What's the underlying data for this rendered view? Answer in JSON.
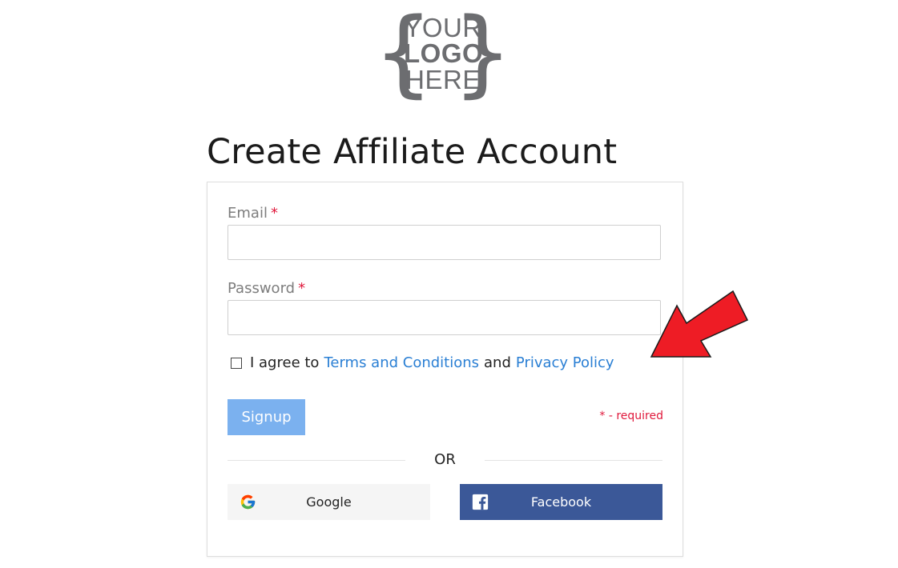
{
  "logo": {
    "brace_left": "{",
    "brace_right": "}",
    "line1": "YOUR",
    "line2": "LOGO",
    "line3": "HERE"
  },
  "page_title": "Create Affiliate Account",
  "form": {
    "email_label": "Email",
    "password_label": "Password",
    "required_marker": "*",
    "email_value": "",
    "password_value": "",
    "agree_prefix": "I agree to",
    "terms_link": "Terms and Conditions",
    "agree_and": "and",
    "privacy_link": "Privacy Policy",
    "agree_checked": false,
    "signup_label": "Signup",
    "required_note": "* - required",
    "or_text": "OR",
    "google_label": "Google",
    "facebook_label": "Facebook"
  },
  "icons": {
    "google": "google-g-icon",
    "facebook": "facebook-f-icon",
    "annotation": "red-arrow-icon"
  },
  "colors": {
    "link": "#2a7fd4",
    "required": "#e0193c",
    "signup_button": "#7bb1ef",
    "facebook_button": "#3b5898",
    "google_button": "#f5f5f5",
    "arrow": "#ee1c25"
  }
}
